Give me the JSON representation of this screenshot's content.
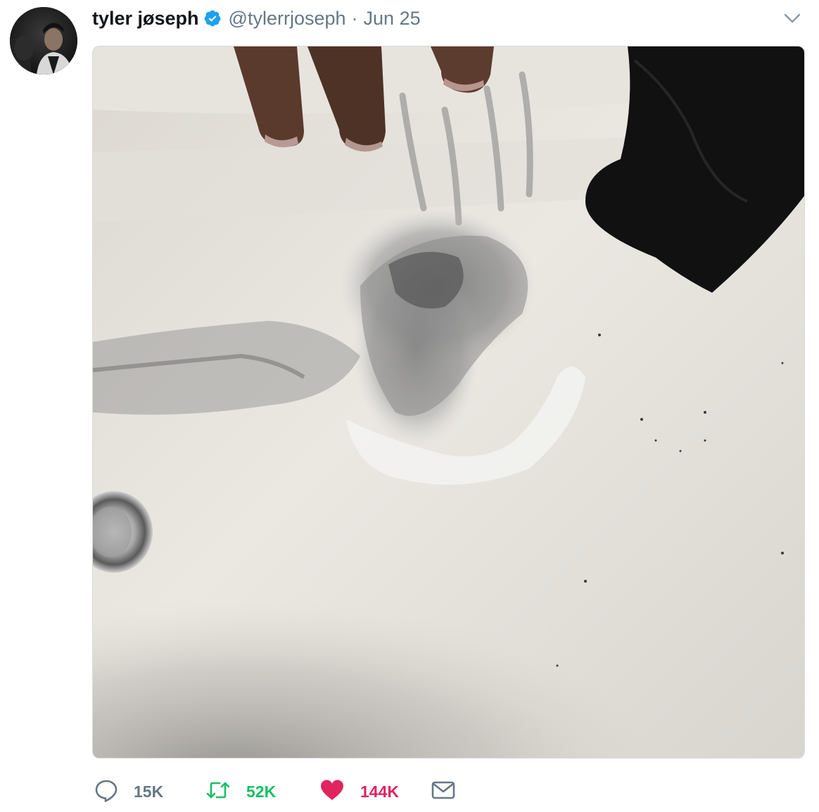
{
  "user": {
    "display_name": "tyler jøseph",
    "handle": "@tylerrjoseph",
    "separator": "·",
    "date": "Jun 25",
    "verified": true,
    "avatar_icon": "profile-photo"
  },
  "menu": {
    "icon": "chevron-down-icon"
  },
  "media": {
    "icon": "photo-sink-handprint"
  },
  "actions": {
    "reply": {
      "icon": "reply-bubble-icon",
      "count": "15K"
    },
    "retweet": {
      "icon": "retweet-arrows-icon",
      "count": "52K"
    },
    "like": {
      "icon": "heart-icon",
      "count": "144K"
    },
    "dm": {
      "icon": "envelope-icon"
    }
  },
  "colors": {
    "text": "#14171a",
    "secondary": "#657786",
    "verified": "#1da1f2",
    "retweet": "#17bf63",
    "like": "#e0245e"
  }
}
